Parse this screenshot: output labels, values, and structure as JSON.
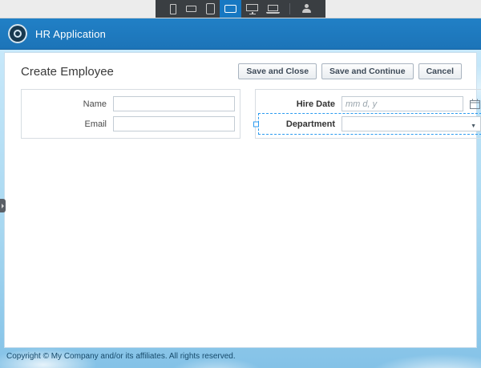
{
  "toolbar": {
    "device_icons": [
      "phone-portrait",
      "phone-landscape",
      "tablet-portrait",
      "tablet-landscape",
      "desktop",
      "laptop"
    ],
    "selected_device": "tablet-landscape",
    "user_icon": "user-menu"
  },
  "header": {
    "app_title": "HR Application"
  },
  "page": {
    "title": "Create Employee",
    "buttons": [
      {
        "label": "Save and Close"
      },
      {
        "label": "Save and Continue"
      },
      {
        "label": "Cancel"
      }
    ]
  },
  "form_left": {
    "fields": [
      {
        "label": "Name",
        "value": ""
      },
      {
        "label": "Email",
        "value": ""
      }
    ]
  },
  "form_right": {
    "hire_date": {
      "label": "Hire Date",
      "placeholder": "mm d, y",
      "value": ""
    },
    "department": {
      "label": "Department",
      "value": "",
      "selected": true
    }
  },
  "footer": {
    "copyright": "Copyright © My Company and/or its affiliates. All rights reserved."
  },
  "colors": {
    "header_blue": "#1f7cc1",
    "selected_device_blue": "#1778c2",
    "selection_blue": "#2b9bf0",
    "toolbar_dark": "#3a3e42",
    "sky_blue": "#a8d8f1"
  }
}
